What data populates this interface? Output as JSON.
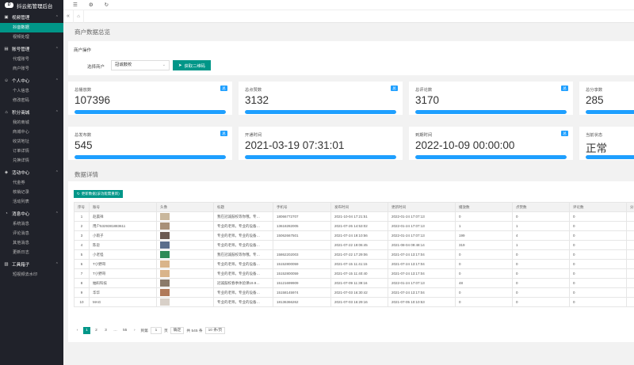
{
  "app": {
    "title": "抖云拓管理后台",
    "logo_letter": "D"
  },
  "sidebar": {
    "groups": [
      {
        "label": "视频管理",
        "icon": "video-icon",
        "items": [
          "抖音数据",
          "视频处理"
        ]
      },
      {
        "label": "账号管理",
        "icon": "user-manage-icon",
        "items": [
          "代理账号",
          "商户账号"
        ]
      },
      {
        "label": "个人中心",
        "icon": "person-icon",
        "items": [
          "个人信息",
          "修改密码"
        ]
      },
      {
        "label": "积分商城",
        "icon": "shop-icon",
        "items": [
          "我的商城",
          "商城中心",
          "收货地址",
          "订单详情",
          "兑换详情"
        ]
      },
      {
        "label": "活动中心",
        "icon": "activity-icon",
        "items": [
          "代金券",
          "核销记录",
          "活动列表"
        ]
      },
      {
        "label": "消息中心",
        "icon": "bell-icon",
        "items": [
          "系统消息",
          "评论消息",
          "其他消息",
          "更新日志"
        ]
      },
      {
        "label": "工具箱子",
        "icon": "toolbox-icon",
        "items": [
          "短视频去水印"
        ]
      }
    ]
  },
  "topbar": {
    "icons": [
      "menu-icon",
      "settings-icon",
      "refresh-icon"
    ]
  },
  "tabs": {
    "left": "«",
    "home": "⌂"
  },
  "page": {
    "title": "商户数据总览",
    "detail_title": "数据详情"
  },
  "operation": {
    "title": "商户操作",
    "select_label": "选择商户",
    "select_value": "冠诚鼓校",
    "button_label": "获取二维码"
  },
  "stats": [
    {
      "label": "总播放数",
      "value": "107396",
      "badge": "总",
      "fill": 1.0
    },
    {
      "label": "总点赞数",
      "value": "3132",
      "badge": "总",
      "fill": 1.0
    },
    {
      "label": "总评论数",
      "value": "3170",
      "badge": "总",
      "fill": 1.0
    },
    {
      "label": "总分享数",
      "value": "285",
      "badge": "总",
      "fill": 1.0
    },
    {
      "label": "总发布数",
      "value": "545",
      "badge": "总",
      "fill": 1.0
    },
    {
      "label": "开通时间",
      "value": "2021-03-19 07:31:01",
      "badge": "",
      "fill": 1.0
    },
    {
      "label": "到期时间",
      "value": "2022-10-09 00:00:00",
      "badge": "总",
      "fill": 1.0
    },
    {
      "label": "当前状态",
      "value": "正常",
      "badge": "",
      "fill": 1.0
    }
  ],
  "table": {
    "refresh_label": "更新数据(该功能需重新)",
    "columns": [
      "序号",
      "账号",
      "头像",
      "标题",
      "手机号",
      "发布时间",
      "更新时间",
      "播放数",
      "点赞数",
      "评论数",
      "分"
    ],
    "rows": [
      {
        "no": "1",
        "account": "赵晨祥",
        "avatar_color": "#c9b79c",
        "title": "我在冠诚鼓校等你哦。专…",
        "phone": "18066772707",
        "publish": "2021-10-04 17:21:51",
        "update": "2022-01-24 17:07:13",
        "plays": "0",
        "likes": "0",
        "comments": "0"
      },
      {
        "no": "2",
        "account": "用户5329381883611",
        "avatar_color": "#a89078",
        "title": "专业的老师。专业的设备…",
        "phone": "13618282005",
        "publish": "2021-07-26 14:53:02",
        "update": "2022-01-24 17:07:13",
        "plays": "1",
        "likes": "1",
        "comments": "0"
      },
      {
        "no": "3",
        "account": "小雨子",
        "avatar_color": "#6b5a52",
        "title": "专业的老师。专业的设备…",
        "phone": "15062667501",
        "publish": "2021-07-24 19:10:56",
        "update": "2022-01-24 17:07:13",
        "plays": "199",
        "likes": "4",
        "comments": "0"
      },
      {
        "no": "4",
        "account": "陈皂",
        "avatar_color": "#5a6e8c",
        "title": "专业的老师。专业的设备…",
        "phone": "",
        "publish": "2021-07-22 19:06:45",
        "update": "2021-08-04 09:48:14",
        "plays": "319",
        "likes": "1",
        "comments": "0"
      },
      {
        "no": "5",
        "account": "小老怪",
        "avatar_color": "#2e8b57",
        "title": "我在冠诚鼓校等你哦。专…",
        "phone": "15862202003",
        "publish": "2021-07-22 17:29:06",
        "update": "2021-07-24 13:17:04",
        "plays": "0",
        "likes": "0",
        "comments": "0"
      },
      {
        "no": "6",
        "account": "T小野哥",
        "avatar_color": "#d9b48a",
        "title": "专业的老师。专业的设备…",
        "phone": "15152800059",
        "publish": "2021-07-15 11:41:15",
        "update": "2021-07-24 13:17:04",
        "plays": "0",
        "likes": "0",
        "comments": "0"
      },
      {
        "no": "7",
        "account": "T小野哥",
        "avatar_color": "#d9b48a",
        "title": "专业的老师。专业的设备…",
        "phone": "15152800059",
        "publish": "2021-07-15 11:40:40",
        "update": "2021-07-24 13:17:04",
        "plays": "0",
        "likes": "0",
        "comments": "0"
      },
      {
        "no": "8",
        "account": "抽码科技",
        "avatar_color": "#8a7a6a",
        "title": "冠诚鼓校春季体验课19.9…",
        "phone": "15121699909",
        "publish": "2021-07-09 11:39:16",
        "update": "2022-01-24 17:07:13",
        "plays": "48",
        "likes": "0",
        "comments": "0"
      },
      {
        "no": "9",
        "account": "华华",
        "avatar_color": "#b07a5a",
        "title": "专业的老师。专业的设备…",
        "phone": "15158145974",
        "publish": "2021-07-03 16:30:42",
        "update": "2021-07-24 13:17:04",
        "plays": "0",
        "likes": "0",
        "comments": "0"
      },
      {
        "no": "10",
        "account": "MAG",
        "avatar_color": "#d8d0c8",
        "title": "专业的老师。专业的设备…",
        "phone": "18136366262",
        "publish": "2021-07-03 16:29:16",
        "update": "2021-07-05 10:10:53",
        "plays": "0",
        "likes": "0",
        "comments": "0"
      }
    ]
  },
  "pager": {
    "prev": "‹",
    "pages": [
      "1",
      "2",
      "3",
      "…",
      "55"
    ],
    "next": "›",
    "goto_label": "到第",
    "goto_value": "1",
    "page_unit": "页",
    "confirm": "确定",
    "total": "共 545 条",
    "per_page": "10 条/页"
  }
}
